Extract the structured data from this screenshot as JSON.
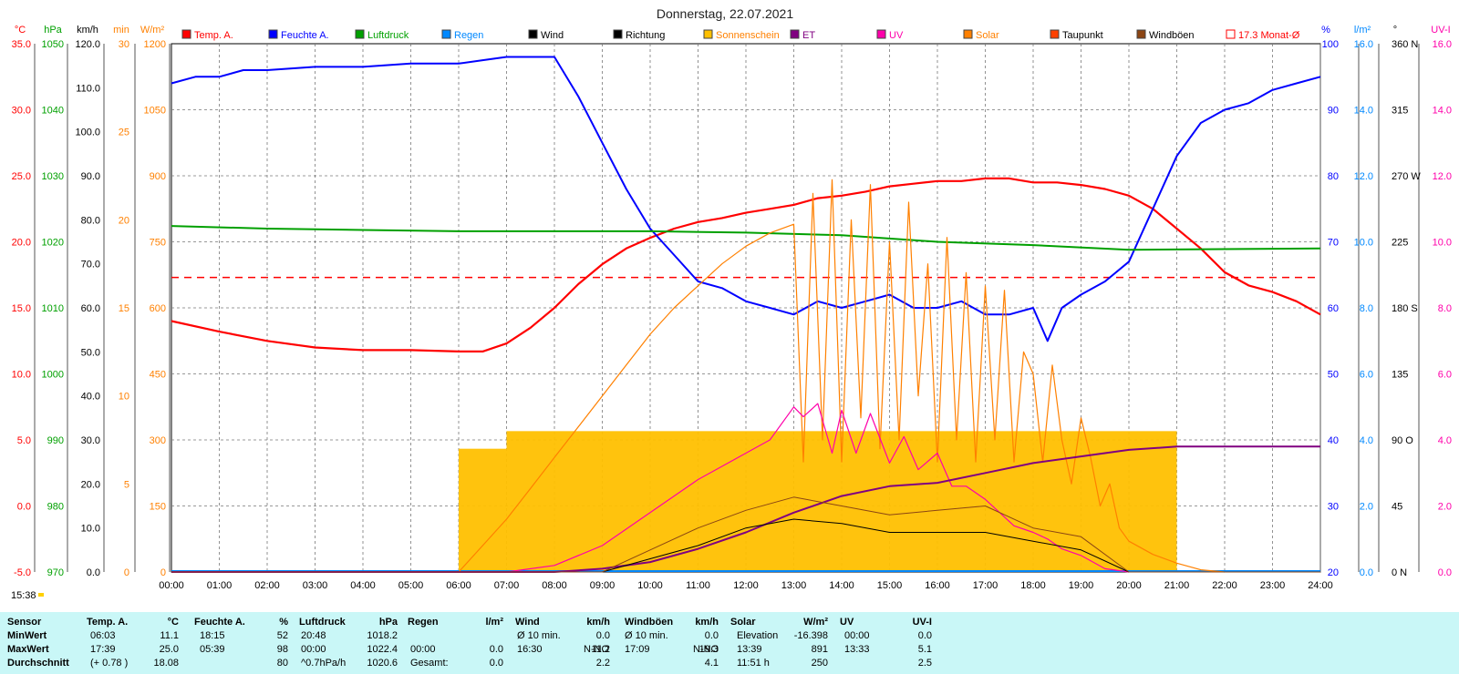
{
  "title": "Donnerstag, 22.07.2021",
  "time_marker": "15:38",
  "colors": {
    "temp": "#ff0000",
    "humidity": "#0000ff",
    "pressure": "#00a000",
    "rain": "#0088ff",
    "wind": "#000000",
    "direction": "#000000",
    "sunshine": "#ffc000",
    "et": "#800080",
    "uv": "#ff00aa",
    "solar": "#ff8000",
    "dewpoint": "#ff4000",
    "gusts": "#8b4513",
    "month_avg": "#ff0000",
    "stats_bg": "#c9f7f7"
  },
  "chart_data": {
    "type": "line",
    "x_labels": [
      "00:00",
      "01:00",
      "02:00",
      "03:00",
      "04:00",
      "05:00",
      "06:00",
      "07:00",
      "08:00",
      "09:00",
      "10:00",
      "11:00",
      "12:00",
      "13:00",
      "14:00",
      "15:00",
      "16:00",
      "17:00",
      "18:00",
      "19:00",
      "20:00",
      "21:00",
      "22:00",
      "23:00",
      "24:00"
    ],
    "legend": [
      "Temp. A.",
      "Feuchte A.",
      "Luftdruck",
      "Regen",
      "Wind",
      "Richtung",
      "Sonnenschein",
      "ET",
      "UV",
      "Solar",
      "Taupunkt",
      "Windböen",
      "17.3 Monat-Ø"
    ],
    "axes": {
      "temp": {
        "unit": "°C",
        "min": -5,
        "max": 35,
        "ticks": [
          "35.0",
          "30.0",
          "25.0",
          "20.0",
          "15.0",
          "10.0",
          "5.0",
          "0.0",
          "-5.0"
        ]
      },
      "pressure": {
        "unit": "hPa",
        "min": 970,
        "max": 1050,
        "ticks": [
          "1050",
          "1040",
          "1030",
          "1020",
          "1010",
          "1000",
          "990",
          "980",
          "970"
        ]
      },
      "wind": {
        "unit": "km/h",
        "min": 0,
        "max": 120,
        "ticks": [
          "120.0",
          "110.0",
          "100.0",
          "90.0",
          "80.0",
          "70.0",
          "60.0",
          "50.0",
          "40.0",
          "30.0",
          "20.0",
          "10.0",
          "0.0"
        ]
      },
      "sunshine": {
        "unit": "min",
        "min": 0,
        "max": 30,
        "ticks": [
          "30",
          "25",
          "20",
          "15",
          "10",
          "5",
          "0"
        ]
      },
      "solar": {
        "unit": "W/m²",
        "min": 0,
        "max": 1200,
        "ticks": [
          "1200",
          "1050",
          "900",
          "750",
          "600",
          "450",
          "300",
          "150",
          "0"
        ]
      },
      "humidity": {
        "unit": "%",
        "min": 20,
        "max": 100,
        "ticks": [
          "100",
          "90",
          "80",
          "70",
          "60",
          "50",
          "40",
          "30",
          "20"
        ]
      },
      "rain": {
        "unit": "l/m²",
        "min": 0,
        "max": 16,
        "ticks": [
          "16.0",
          "14.0",
          "12.0",
          "10.0",
          "8.0",
          "6.0",
          "4.0",
          "2.0",
          "0.0"
        ]
      },
      "direction": {
        "unit": "°",
        "min": 0,
        "max": 360,
        "ticks": [
          "360 N",
          "315",
          "270 W",
          "225",
          "180 S",
          "135",
          "90 O",
          "45",
          "0 N"
        ]
      },
      "uv": {
        "unit": "UV-I",
        "min": 0,
        "max": 16,
        "ticks": [
          "16.0",
          "14.0",
          "12.0",
          "10.0",
          "8.0",
          "6.0",
          "4.0",
          "2.0",
          "0.0"
        ]
      }
    },
    "month_avg_temp": 17.3,
    "series": [
      {
        "name": "Temp. A.",
        "unit": "°C",
        "x": [
          0,
          1,
          2,
          3,
          4,
          5,
          6,
          6.5,
          7,
          7.5,
          8,
          8.5,
          9,
          9.5,
          10,
          10.5,
          11,
          11.5,
          12,
          12.5,
          13,
          13.5,
          14,
          14.5,
          15,
          15.5,
          16,
          16.5,
          17,
          17.5,
          18,
          18.5,
          19,
          19.5,
          20,
          20.5,
          21,
          21.5,
          22,
          22.5,
          23,
          23.5,
          24
        ],
        "y": [
          14,
          13.2,
          12.5,
          12,
          11.8,
          11.8,
          11.7,
          11.7,
          12.3,
          13.5,
          15,
          16.8,
          18.3,
          19.5,
          20.3,
          21,
          21.5,
          21.8,
          22.2,
          22.5,
          22.8,
          23.3,
          23.5,
          23.8,
          24.2,
          24.4,
          24.6,
          24.6,
          24.8,
          24.8,
          24.5,
          24.5,
          24.3,
          24,
          23.5,
          22.5,
          21,
          19.5,
          17.7,
          16.7,
          16.2,
          15.5,
          14.5
        ]
      },
      {
        "name": "Feuchte A.",
        "unit": "%",
        "x": [
          0,
          0.5,
          1,
          1.5,
          2,
          3,
          4,
          5,
          5.5,
          6,
          6.5,
          7,
          7.5,
          8,
          8.5,
          9,
          9.5,
          10,
          10.5,
          11,
          11.5,
          12,
          12.5,
          13,
          13.5,
          14,
          14.5,
          15,
          15.5,
          16,
          16.5,
          17,
          17.5,
          18,
          18.3,
          18.6,
          19,
          19.5,
          20,
          20.5,
          21,
          21.5,
          22,
          22.5,
          23,
          23.5,
          24
        ],
        "y": [
          94,
          95,
          95,
          96,
          96,
          96.5,
          96.5,
          97,
          97,
          97,
          97.5,
          98,
          98,
          98,
          92,
          85,
          78,
          72,
          68,
          64,
          63,
          61,
          60,
          59,
          61,
          60,
          61,
          62,
          60,
          60,
          61,
          59,
          59,
          60,
          55,
          60,
          62,
          64,
          67,
          75,
          83,
          88,
          90,
          91,
          93,
          94,
          95
        ]
      },
      {
        "name": "Luftdruck",
        "unit": "hPa",
        "x": [
          0,
          2,
          4,
          6,
          8,
          10,
          12,
          14,
          15,
          16,
          18,
          20,
          22,
          24
        ],
        "y": [
          1022.4,
          1022,
          1021.8,
          1021.6,
          1021.6,
          1021.6,
          1021.4,
          1021,
          1020.5,
          1020,
          1019.5,
          1018.8,
          1018.9,
          1019
        ]
      },
      {
        "name": "Solar",
        "unit": "W/m²",
        "x": [
          6,
          6.5,
          7,
          7.5,
          8,
          8.5,
          9,
          9.5,
          10,
          10.5,
          11,
          11.5,
          12,
          12.5,
          13,
          13.2,
          13.4,
          13.6,
          13.8,
          14,
          14.2,
          14.4,
          14.6,
          14.8,
          15,
          15.2,
          15.4,
          15.6,
          15.8,
          16,
          16.2,
          16.4,
          16.6,
          16.8,
          17,
          17.2,
          17.4,
          17.6,
          17.8,
          18,
          18.2,
          18.4,
          18.6,
          18.8,
          19,
          19.2,
          19.4,
          19.6,
          19.8,
          20,
          20.5,
          21,
          21.5,
          22
        ],
        "y": [
          0,
          60,
          120,
          190,
          260,
          330,
          400,
          470,
          540,
          600,
          650,
          700,
          740,
          770,
          790,
          250,
          860,
          300,
          891,
          250,
          800,
          350,
          880,
          280,
          750,
          300,
          840,
          400,
          700,
          250,
          760,
          300,
          680,
          250,
          650,
          300,
          640,
          250,
          500,
          450,
          250,
          470,
          300,
          200,
          350,
          260,
          150,
          200,
          100,
          70,
          40,
          20,
          5,
          0
        ]
      },
      {
        "name": "UV",
        "unit": "UV-I",
        "x": [
          7,
          8,
          9,
          10,
          11,
          11.5,
          12,
          12.5,
          13,
          13.2,
          13.5,
          13.8,
          14,
          14.3,
          14.6,
          15,
          15.3,
          15.6,
          16,
          16.3,
          16.6,
          17,
          17.3,
          17.6,
          18,
          18.3,
          18.6,
          19,
          19.5,
          20
        ],
        "y": [
          0,
          0.2,
          0.8,
          1.8,
          2.8,
          3.2,
          3.6,
          4,
          5,
          4.7,
          5.1,
          3.6,
          4.9,
          3.6,
          4.8,
          3.3,
          4.1,
          3.1,
          3.6,
          2.6,
          2.6,
          2.2,
          1.8,
          1.4,
          1.2,
          1,
          0.7,
          0.5,
          0.1,
          0
        ]
      },
      {
        "name": "ET",
        "unit": "l/m²",
        "x": [
          0,
          8,
          9,
          10,
          11,
          12,
          13,
          14,
          15,
          16,
          17,
          18,
          19,
          20,
          21,
          22,
          23,
          24
        ],
        "y": [
          0,
          0,
          0.1,
          0.3,
          0.7,
          1.2,
          1.8,
          2.3,
          2.6,
          2.7,
          3,
          3.3,
          3.5,
          3.7,
          3.8,
          3.8,
          3.8,
          3.8
        ]
      },
      {
        "name": "Wind",
        "unit": "km/h",
        "x": [
          0,
          9,
          10,
          11,
          12,
          13,
          14,
          15,
          16,
          17,
          18,
          19,
          20,
          24
        ],
        "y": [
          0,
          0,
          3,
          6,
          10,
          12,
          11,
          9,
          9,
          9,
          7,
          5,
          0,
          0
        ]
      },
      {
        "name": "Windböen",
        "unit": "km/h",
        "x": [
          0,
          9,
          10,
          11,
          12,
          13,
          14,
          15,
          16,
          17,
          18,
          19,
          20,
          24
        ],
        "y": [
          0,
          0,
          5,
          10,
          14,
          17,
          15,
          13,
          14,
          15,
          10,
          8,
          0,
          0
        ]
      },
      {
        "name": "Sonnenschein",
        "unit": "min",
        "x": [
          6,
          7,
          8,
          9,
          10,
          11,
          12,
          13,
          14,
          15,
          16,
          17,
          18,
          19,
          20,
          21
        ],
        "y": [
          7,
          8,
          8,
          8,
          8,
          8,
          8,
          8,
          8,
          8,
          8,
          8,
          8,
          8,
          8,
          8
        ]
      }
    ]
  },
  "stats": {
    "headers": [
      {
        "label": "Sensor",
        "unit": ""
      },
      {
        "label": "Temp. A.",
        "unit": "°C"
      },
      {
        "label": "Feuchte A.",
        "unit": "%"
      },
      {
        "label": "Luftdruck",
        "unit": "hPa"
      },
      {
        "label": "Regen",
        "unit": "l/m²"
      },
      {
        "label": "Wind",
        "unit": "km/h"
      },
      {
        "label": "Windböen",
        "unit": "km/h"
      },
      {
        "label": "Solar",
        "unit": "W/m²"
      },
      {
        "label": "UV",
        "unit": "UV-I"
      }
    ],
    "row_labels": [
      "MinWert",
      "MaxWert",
      "Durchschnitt"
    ],
    "temp": [
      [
        "06:03",
        "11.1"
      ],
      [
        "17:39",
        "25.0"
      ],
      [
        "(+ 0.78 )",
        "18.08"
      ]
    ],
    "humidity": [
      [
        "18:15",
        "52"
      ],
      [
        "05:39",
        "98"
      ],
      [
        "",
        "80"
      ]
    ],
    "pressure": [
      [
        "20:48",
        "1018.2"
      ],
      [
        "00:00",
        "1022.4"
      ],
      [
        "^0.7hPa/h",
        "1020.6"
      ]
    ],
    "rain": [
      [
        "",
        ""
      ],
      [
        "00:00",
        "0.0"
      ],
      [
        "Gesamt:",
        "0.0"
      ]
    ],
    "wind": [
      [
        "Ø 10 min.",
        "",
        "0.0"
      ],
      [
        "16:30",
        "N-NO",
        "11.2"
      ],
      [
        "",
        "",
        "2.2"
      ]
    ],
    "gusts": [
      [
        "Ø 10 min.",
        "",
        "0.0"
      ],
      [
        "17:09",
        "N-NO",
        "19.3"
      ],
      [
        "",
        "",
        "4.1"
      ]
    ],
    "solar": [
      [
        "Elevation",
        "-16.398"
      ],
      [
        "13:39",
        "891"
      ],
      [
        "11:51 h",
        "250"
      ]
    ],
    "uv": [
      [
        "00:00",
        "0.0"
      ],
      [
        "13:33",
        "5.1"
      ],
      [
        "",
        "2.5"
      ]
    ]
  }
}
